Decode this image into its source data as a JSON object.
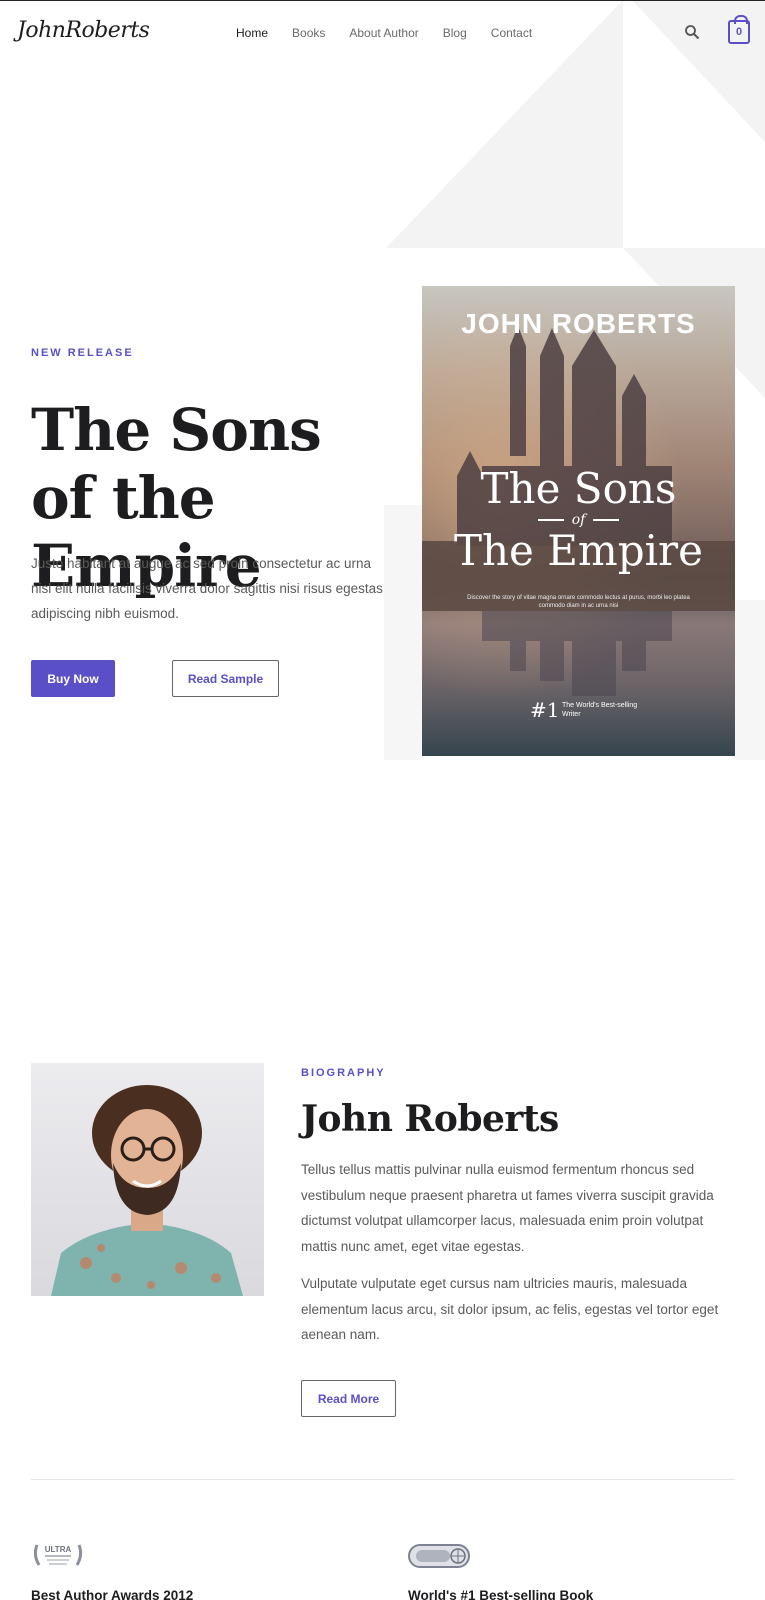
{
  "header": {
    "logo": "JohnRoberts",
    "nav": [
      "Home",
      "Books",
      "About Author",
      "Blog",
      "Contact"
    ],
    "cart_count": "0"
  },
  "hero": {
    "kicker": "NEW RELEASE",
    "title": "The Sons of the Empire",
    "text": "Justo habitant at augue ac sed proin consectetur ac urna nisl elit nulla facilisis viverra dolor sagittis nisi risus egestas adipiscing nibh euismod.",
    "buy_label": "Buy Now",
    "sample_label": "Read Sample"
  },
  "book_cover": {
    "author": "JOHN ROBERTS",
    "title_line1": "The Sons",
    "of": "of",
    "title_line2": "The Empire",
    "blurb": "Discover the story of vitae magna ornare commodo lectus at purus, morbi leo platea commodo diam in ac urna nisi",
    "rank": "#1",
    "rank_note": "The World's Best-selling Writer"
  },
  "bio": {
    "kicker": "BIOGRAPHY",
    "name": "John Roberts",
    "paragraph1": "Tellus tellus mattis pulvinar nulla euismod fermentum rhoncus sed vestibulum neque praesent pharetra ut fames viverra suscipit gravida dictumst volutpat ullamcorper lacus, malesuada enim proin volutpat mattis nunc amet, eget vitae egestas.",
    "paragraph2": "Vulputate vulputate eget cursus nam ultricies mauris, malesuada elementum lacus arcu, sit dolor ipsum, ac felis, egestas vel tortor eget aenean nam.",
    "read_more_label": "Read More"
  },
  "awards": [
    {
      "badge_text": "ULTRA",
      "title": "Best Author Awards 2012"
    },
    {
      "badge_text": "",
      "title": "World's #1 Best-selling Book"
    }
  ],
  "colors": {
    "accent": "#5b4fc7",
    "heading": "#1d1d1f",
    "body": "#5a5a5a"
  }
}
